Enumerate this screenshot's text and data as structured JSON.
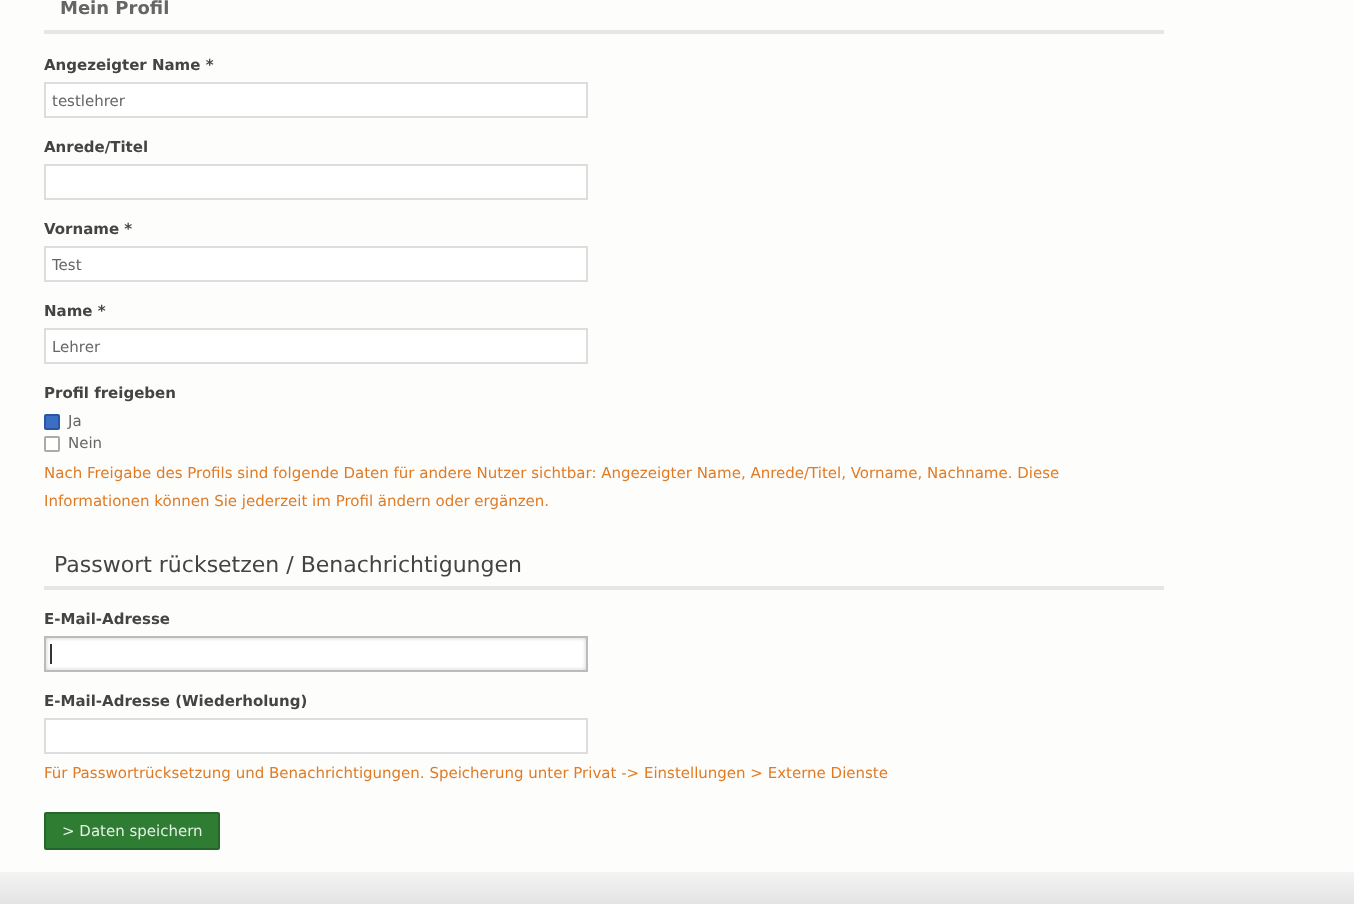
{
  "section_profile": {
    "title": "Mein Profil",
    "fields": [
      {
        "label": "Angezeigter Name *",
        "value": "testlehrer"
      },
      {
        "label": "Anrede/Titel"
      },
      {
        "label": "Vorname *",
        "value": "Test"
      },
      {
        "label": "Name *",
        "value": "Lehrer"
      }
    ],
    "share": {
      "label": "Profil freigeben",
      "options": [
        {
          "label": "Ja",
          "checked": true
        },
        {
          "label": "Nein",
          "checked": false
        }
      ]
    },
    "note": "Nach Freigabe des Profils sind folgende Daten für andere Nutzer sichtbar: Angezeigter Name, Anrede/Titel, Vorname, Nachname. Diese Informationen können Sie jederzeit im Profil ändern oder ergänzen."
  },
  "section_password": {
    "title": "Passwort rücksetzen / Benachrichtigungen",
    "fields": [
      {
        "label": "E-Mail-Adresse",
        "focused": true
      },
      {
        "label": "E-Mail-Adresse (Wiederholung)",
        "focused": false
      }
    ],
    "note": "Für Passwortrücksetzung und Benachrichtigungen. Speicherung unter Privat -> Einstellungen > Externe Dienste"
  },
  "save_button": {
    "icon": ">",
    "label": "Daten speichern"
  }
}
